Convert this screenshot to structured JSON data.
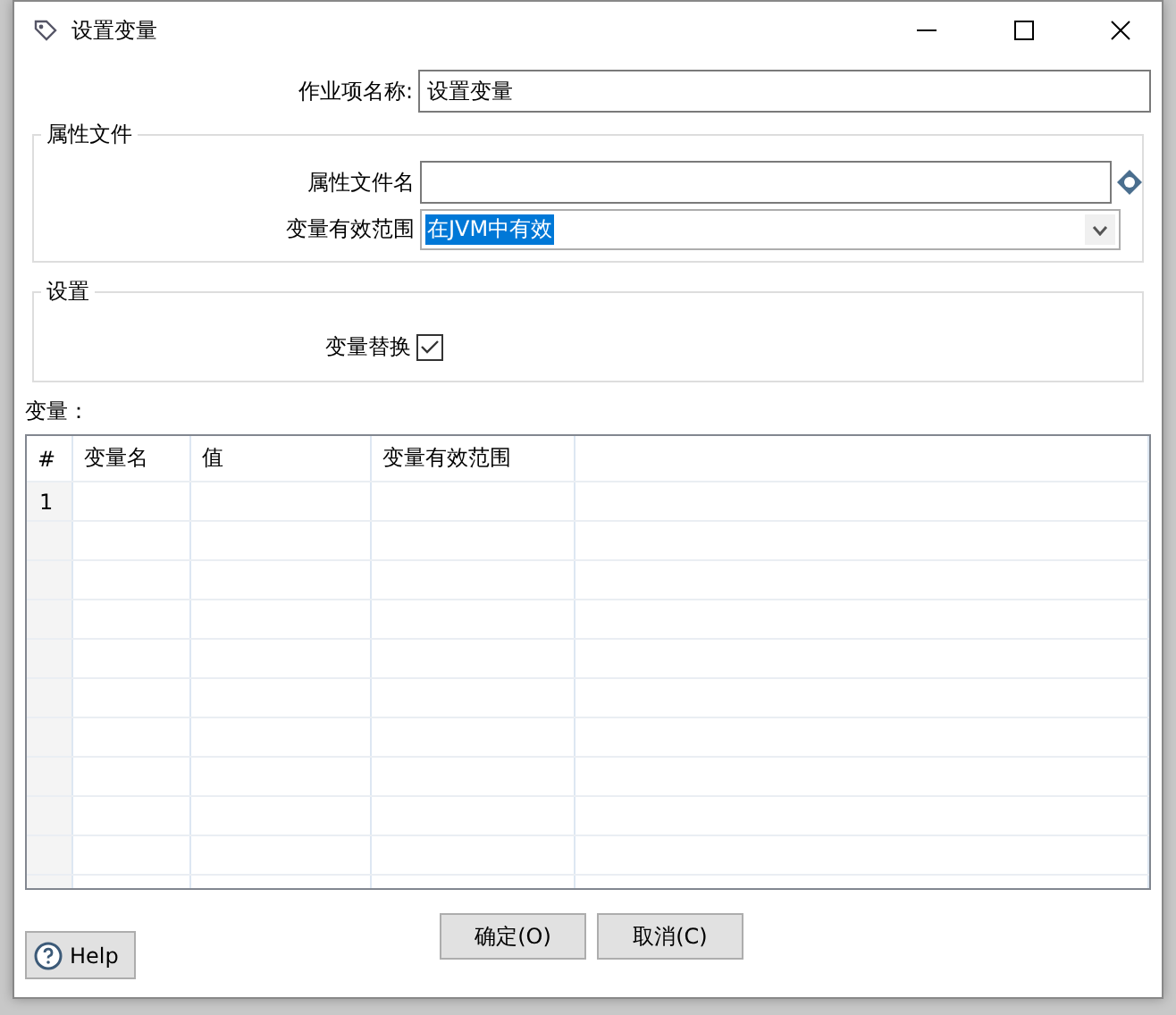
{
  "window": {
    "title": "设置变量"
  },
  "job_name": {
    "label": "作业项名称:",
    "value": "设置变量"
  },
  "property_file": {
    "title": "属性文件",
    "file_label": "属性文件名",
    "scope_label": "变量有效范围",
    "scope_value": "在JVM中有效"
  },
  "settings": {
    "title": "设置",
    "replace_label": "变量替换",
    "checked": true
  },
  "variables": {
    "label": "变量：",
    "columns": [
      "#",
      "变量名",
      "值",
      "变量有效范围"
    ],
    "rows": [
      {
        "number": "1"
      }
    ]
  },
  "buttons": [
    {
      "label": "确定(O)"
    },
    {
      "label": "取消(C)"
    }
  ],
  "help": {
    "label": "Help"
  }
}
